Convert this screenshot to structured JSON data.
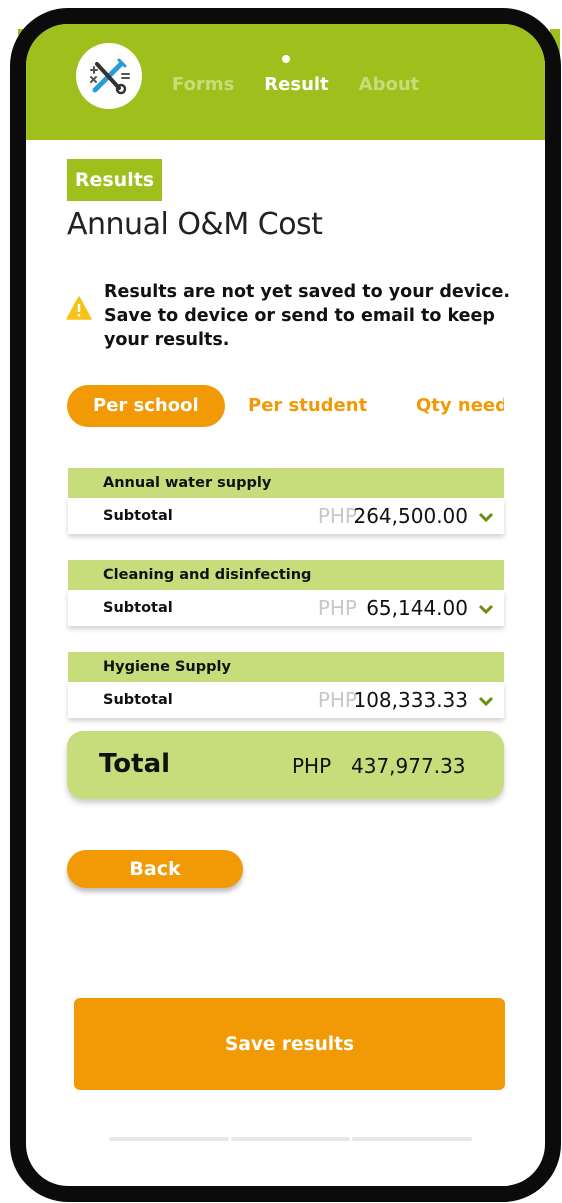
{
  "nav": {
    "items": [
      "Forms",
      "Result",
      "About"
    ],
    "active_index": 1
  },
  "badge": "Results",
  "title": "Annual O&M Cost",
  "warning": "Results are not yet saved to your device. Save to device or send to email to keep your results.",
  "tabs": [
    "Per school",
    "Per student",
    "Qty needed"
  ],
  "groups": [
    {
      "header": "Annual water supply",
      "row_label": "Subtotal",
      "currency": "PHP",
      "amount": "264,500.00"
    },
    {
      "header": "Cleaning and disinfecting",
      "row_label": "Subtotal",
      "currency": "PHP",
      "amount": "65,144.00"
    },
    {
      "header": "Hygiene Supply",
      "row_label": "Subtotal",
      "currency": "PHP",
      "amount": "108,333.33"
    }
  ],
  "total": {
    "label": "Total",
    "currency": "PHP",
    "amount": "437,977.33"
  },
  "buttons": {
    "back": "Back",
    "save": "Save results"
  },
  "colors": {
    "header_green": "#9ebf1c",
    "light_green": "#c7dc7a",
    "accent_orange": "#f29a05"
  },
  "icons": {
    "logo": "tools-logo-icon",
    "warning": "warning-icon",
    "chevron": "chevron-down-icon"
  }
}
